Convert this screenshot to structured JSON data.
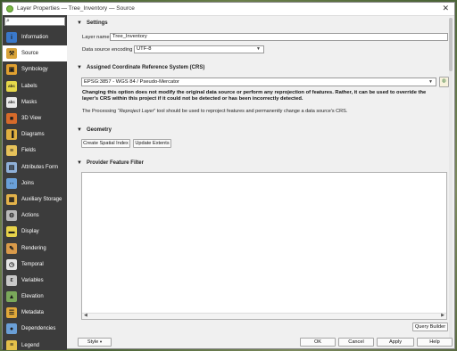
{
  "window": {
    "title": "Layer Properties — Tree_Inventory — Source"
  },
  "sidebar": {
    "search_icon": "magnifier-icon",
    "items": [
      {
        "label": "Information",
        "icon": "info-icon",
        "color": "#3a78c9",
        "glyph": "i"
      },
      {
        "label": "Source",
        "icon": "source-wrench-icon",
        "color": "#d9a43a",
        "glyph": "⚒"
      },
      {
        "label": "Symbology",
        "icon": "symbology-icon",
        "color": "#e0a030",
        "glyph": "▣"
      },
      {
        "label": "Labels",
        "icon": "labels-icon",
        "color": "#e6d84a",
        "glyph": "abc"
      },
      {
        "label": "Masks",
        "icon": "masks-icon",
        "color": "#eaeaea",
        "glyph": "abc"
      },
      {
        "label": "3D View",
        "icon": "cube-icon",
        "color": "#d66a2a",
        "glyph": "■"
      },
      {
        "label": "Diagrams",
        "icon": "diagrams-icon",
        "color": "#e0b040",
        "glyph": "▐"
      },
      {
        "label": "Fields",
        "icon": "fields-icon",
        "color": "#e6c25a",
        "glyph": "≡"
      },
      {
        "label": "Attributes Form",
        "icon": "attributes-form-icon",
        "color": "#8fb0d8",
        "glyph": "▤"
      },
      {
        "label": "Joins",
        "icon": "joins-icon",
        "color": "#6aa0d8",
        "glyph": "↔"
      },
      {
        "label": "Auxiliary Storage",
        "icon": "auxiliary-storage-icon",
        "color": "#e3b24a",
        "glyph": "▦"
      },
      {
        "label": "Actions",
        "icon": "actions-gear-icon",
        "color": "#b8b8b8",
        "glyph": "⚙"
      },
      {
        "label": "Display",
        "icon": "display-speech-icon",
        "color": "#e7d24a",
        "glyph": "▬"
      },
      {
        "label": "Rendering",
        "icon": "rendering-brush-icon",
        "color": "#d99a4a",
        "glyph": "✎"
      },
      {
        "label": "Temporal",
        "icon": "temporal-clock-icon",
        "color": "#e4e4e4",
        "glyph": "◷"
      },
      {
        "label": "Variables",
        "icon": "variables-icon",
        "color": "#c8c8c8",
        "glyph": "ε"
      },
      {
        "label": "Elevation",
        "icon": "elevation-icon",
        "color": "#7aa85a",
        "glyph": "▲"
      },
      {
        "label": "Metadata",
        "icon": "metadata-icon",
        "color": "#e0a83a",
        "glyph": "☰"
      },
      {
        "label": "Dependencies",
        "icon": "dependencies-icon",
        "color": "#6a9fd6",
        "glyph": "●"
      },
      {
        "label": "Legend",
        "icon": "legend-icon",
        "color": "#e4c04a",
        "glyph": "≡"
      }
    ],
    "active_index": 1
  },
  "settings": {
    "heading": "Settings",
    "layer_name_label": "Layer name",
    "layer_name_value": "Tree_Inventory",
    "encoding_label": "Data source encoding",
    "encoding_value": "UTF-8"
  },
  "crs": {
    "heading": "Assigned Coordinate Reference System (CRS)",
    "value": "EPSG:3857 - WGS 84 / Pseudo-Mercator",
    "selector_icon": "crs-selector-globe-icon",
    "warning_line1": "Changing this option does not modify the original data source or perform any reprojection of features. Rather, it can be used to override the",
    "warning_line2": "layer's CRS within this project if it could not be detected or has been incorrectly detected.",
    "note_pre": "The Processing “",
    "note_tool": "Reproject Layer",
    "note_post": "” tool should be used to reproject features and permanently change a data source's CRS."
  },
  "geometry": {
    "heading": "Geometry",
    "create_spatial_index": "Create Spatial Index",
    "update_extents": "Update Extents"
  },
  "filter": {
    "heading": "Provider Feature Filter",
    "query_builder": "Query Builder"
  },
  "footer": {
    "style": "Style",
    "ok": "OK",
    "cancel": "Cancel",
    "apply": "Apply",
    "help": "Help"
  }
}
